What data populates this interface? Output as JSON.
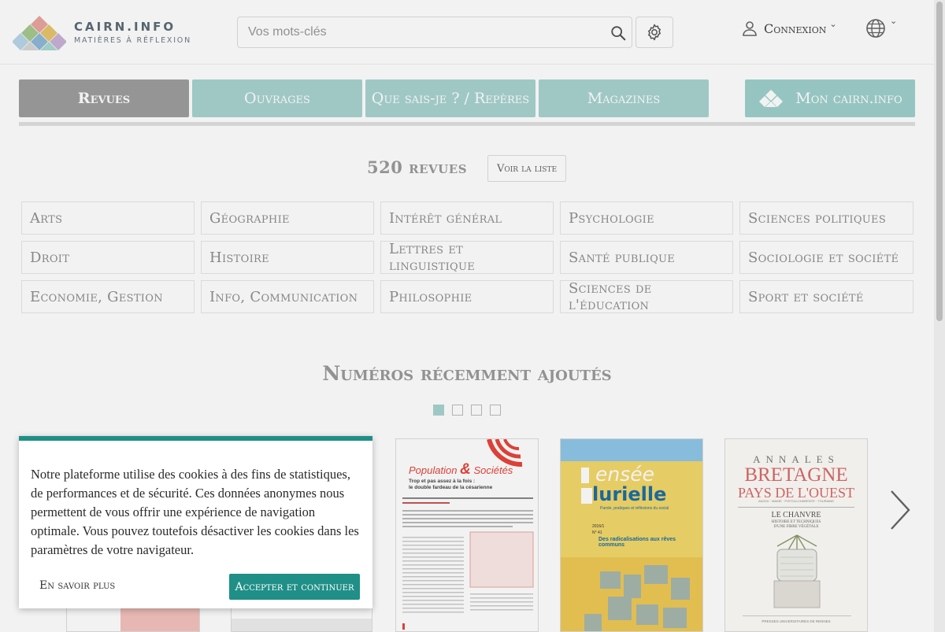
{
  "header": {
    "logo_name": "CAIRN.INFO",
    "logo_tagline": "MATIÈRES À RÉFLEXION",
    "search_placeholder": "Vos mots-clés",
    "login_label": "Connexion"
  },
  "tabs": [
    {
      "label": "Revues",
      "active": true
    },
    {
      "label": "Ouvrages",
      "active": false
    },
    {
      "label": "Que sais-je ? / Repères",
      "active": false
    },
    {
      "label": "Magazines",
      "active": false
    },
    {
      "label": "Mon cairn.info",
      "active": false
    }
  ],
  "revues": {
    "count_label": "520 revues",
    "list_button": "Voir la liste"
  },
  "categories": [
    "Arts",
    "Géographie",
    "Intérêt général",
    "Psychologie",
    "Sciences politiques",
    "Droit",
    "Histoire",
    "Lettres et linguistique",
    "Santé publique",
    "Sociologie et société",
    "Economie, Gestion",
    "Info, Communication",
    "Philosophie",
    "Sciences de l'éducation",
    "Sport et société"
  ],
  "recent": {
    "title": "Numéros récemment ajoutés",
    "pages": 4,
    "current_page": 1,
    "covers": [
      {
        "title_a": "Population",
        "amp": "&",
        "title_b": "Sociétés",
        "headline": "Trop et pas assez à la fois :",
        "headline2": "le double fardeau de la césarienne"
      },
      {
        "title_a": "ensée",
        "title_b": "lurielle",
        "subtitle": "Parole, pratiques et réflexions du social",
        "headline": "Des radicalisations aux rêves communs",
        "issue": "2016/1",
        "issue_no": "N° 41"
      },
      {
        "line1": "ANNALES",
        "line2": "BRETAGNE",
        "line3": "PAYS DE L'OUEST",
        "line4": "ANJOU · MAINE · POITOU-CHARENTE · TOURAINE",
        "headline": "LE CHANVRE",
        "headline2": "HISTOIRE ET TECHNIQUES",
        "headline3": "D'UNE FIBRE VÉGÉTALE",
        "footer": "PRESSES UNIVERSITAIRES DE RENNES"
      }
    ]
  },
  "cookie": {
    "text": "Notre plateforme utilise des cookies à des fins de statistiques, de performances et de sécurité. Ces données anonymes nous permettent de vous offrir une expérience de navigation optimale. Vous pouvez toutefois désactiver les cookies dans les paramètres de votre navigateur.",
    "more_label": "En savoir plus",
    "accept_label": "Accepter et continuer"
  },
  "colors": {
    "brand_teal": "#1f8f87",
    "tab_light": "#a8d3d0",
    "tab_active": "#9e9e9e"
  }
}
